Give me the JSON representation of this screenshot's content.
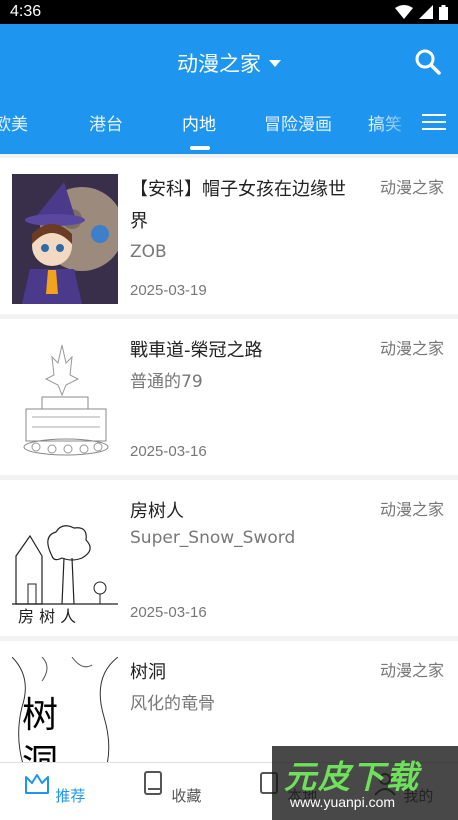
{
  "status_bar": {
    "time": "4:36"
  },
  "header": {
    "title": "动漫之家",
    "tabs": [
      "欧美",
      "港台",
      "内地",
      "冒险漫画",
      "搞笑"
    ],
    "active_tab_index": 2
  },
  "list": [
    {
      "title": "【安科】帽子女孩在边缘世界",
      "author": "ZOB",
      "date": "2025-03-19",
      "source": "动漫之家"
    },
    {
      "title": "戰車道-榮冠之路",
      "author": "普通的79",
      "date": "2025-03-16",
      "source": "动漫之家"
    },
    {
      "title": "房树人",
      "author": "Super_Snow_Sword",
      "date": "2025-03-16",
      "source": "动漫之家"
    },
    {
      "title": "树洞",
      "author": "风化的竜骨",
      "date": "",
      "source": "动漫之家"
    }
  ],
  "bottom_nav": [
    {
      "label": "推荐",
      "active": true
    },
    {
      "label": "收藏",
      "active": false
    },
    {
      "label": "本地",
      "active": false
    },
    {
      "label": "我的",
      "active": false
    }
  ],
  "watermark": {
    "main": "元皮下载",
    "url": "www.yuanpi.com"
  },
  "colors": {
    "primary": "#1e96f0",
    "watermark_green": "#6fe05a"
  }
}
